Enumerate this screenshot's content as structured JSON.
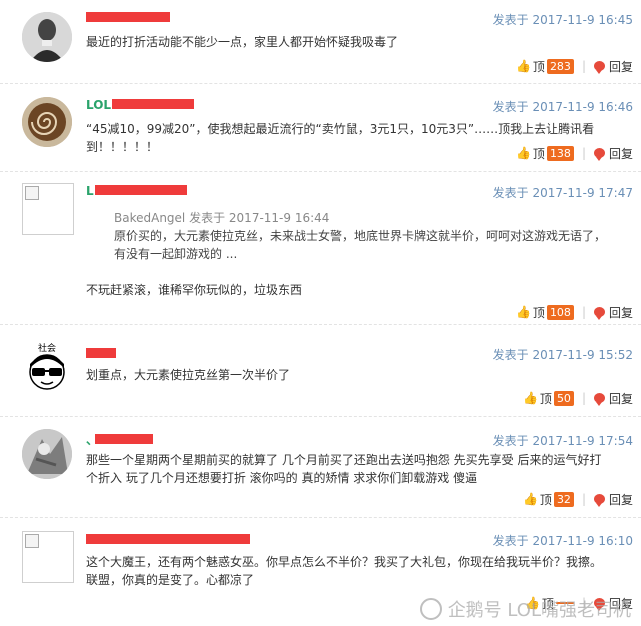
{
  "posts": [
    {
      "username_visible": "",
      "date": "发表于 2017-11-9 16:45",
      "content": "最近的打折活动能不能少一点，家里人都开始怀疑我吸毒了",
      "like_label": "顶",
      "like_count": "283",
      "reply_label": "回复"
    },
    {
      "username_visible": "LOL",
      "date": "发表于 2017-11-9 16:46",
      "content": "“45减10，99减20”，使我想起最近流行的“卖竹鼠，3元1只，10元3只”……顶我上去让腾讯看到！！！！！",
      "like_label": "顶",
      "like_count": "138",
      "reply_label": "回复"
    },
    {
      "username_visible": "L",
      "date": "发表于 2017-11-9 17:47",
      "quote_author": "BakedAngel",
      "quote_date": "发表于 2017-11-9 16:44",
      "quote_text": "原价买的，大元素使拉克丝，未来战士女警，地底世界卡牌这就半价，呵呵对这游戏无语了，有没有一起卸游戏的 ...",
      "content": "不玩赶紧滚，谁稀罕你玩似的，垃圾东西",
      "like_label": "顶",
      "like_count": "108",
      "reply_label": "回复"
    },
    {
      "username_visible": "",
      "avatar_text": "社会",
      "date": "发表于 2017-11-9 15:52",
      "content": "划重点，大元素使拉克丝第一次半价了",
      "like_label": "顶",
      "like_count": "50",
      "reply_label": "回复"
    },
    {
      "username_visible": "、",
      "date": "发表于 2017-11-9 17:54",
      "content": "那些一个星期两个星期前买的就算了 几个月前买了还跑出去送吗抱怨 先买先享受 后来的运气好打个折入 玩了几个月还想要打折 滚你吗的 真的矫情 求求你们卸载游戏 傻逼",
      "like_label": "顶",
      "like_count": "32",
      "reply_label": "回复"
    },
    {
      "username_visible": "",
      "date": "发表于 2017-11-9 16:10",
      "content": "这个大魔王，还有两个魅惑女巫。你早点怎么不半价？我买了大礼包，你现在给我玩半价？我擦。联盟，你真的是变了。心都凉了",
      "like_label": "顶",
      "like_count": "",
      "reply_label": "回复"
    }
  ],
  "watermark": "企鹅号 LOL嘴强老司机",
  "colors": {
    "badge": "#ee6b1f",
    "username": "#2aa36b",
    "date": "#6a8fb6",
    "redaction": "#ef3b3b"
  }
}
